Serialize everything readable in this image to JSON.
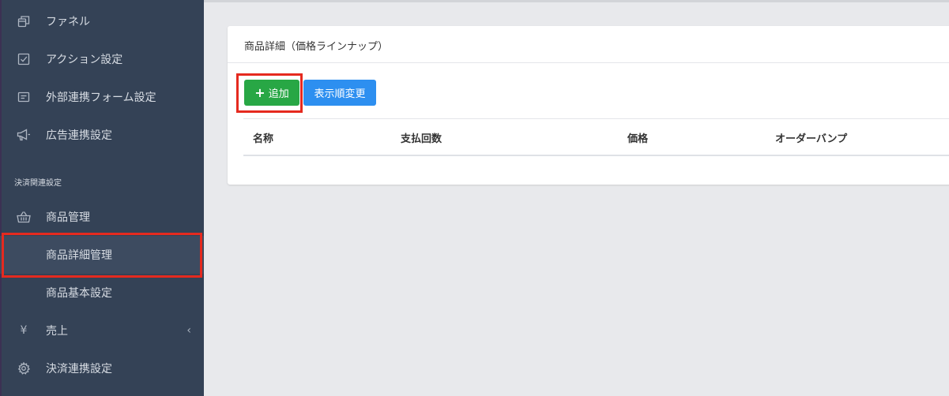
{
  "sidebar": {
    "items": [
      {
        "label": "ファネル",
        "icon": "funnel-copy-icon"
      },
      {
        "label": "アクション設定",
        "icon": "checkbox-icon"
      },
      {
        "label": "外部連携フォーム設定",
        "icon": "form-icon"
      },
      {
        "label": "広告連携設定",
        "icon": "megaphone-icon"
      }
    ],
    "section_header": "決済関連設定",
    "payment_items": [
      {
        "label": "商品管理",
        "icon": "basket-icon"
      },
      {
        "label": "商品詳細管理",
        "active": true
      },
      {
        "label": "商品基本設定"
      },
      {
        "label": "売上",
        "icon": "yen-icon",
        "chevron": "‹"
      },
      {
        "label": "決済連携設定",
        "icon": "gear-icon"
      }
    ],
    "yen_glyph": "¥"
  },
  "card": {
    "title": "商品詳細（価格ラインナップ）",
    "add_button": {
      "plus": "+",
      "label": "追加"
    },
    "order_button": {
      "label": "表示順変更"
    },
    "table": {
      "columns": [
        "名称",
        "支払回数",
        "価格",
        "オーダーバンプ"
      ]
    }
  },
  "colors": {
    "sidebar_bg": "#344256",
    "add_button": "#28a745",
    "order_button": "#2d8ff0",
    "highlight": "#e52a1f"
  }
}
